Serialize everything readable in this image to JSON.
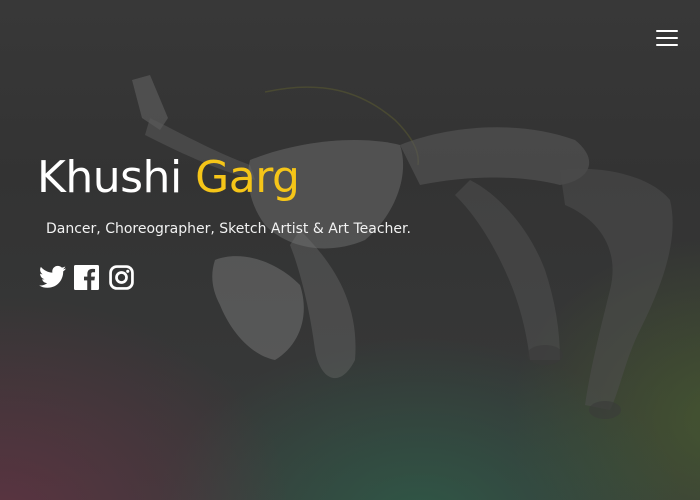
{
  "header": {
    "menu_icon": "hamburger-menu-icon"
  },
  "hero": {
    "first_name": "Khushi",
    "last_name": "Garg",
    "tagline": "Dancer, Choreographer, Sketch Artist & Art Teacher."
  },
  "social": [
    {
      "name": "twitter",
      "icon": "twitter-icon"
    },
    {
      "name": "facebook",
      "icon": "facebook-icon"
    },
    {
      "name": "instagram",
      "icon": "instagram-icon"
    }
  ],
  "colors": {
    "accent": "#f5c518",
    "text": "#ffffff",
    "background": "#353535"
  }
}
